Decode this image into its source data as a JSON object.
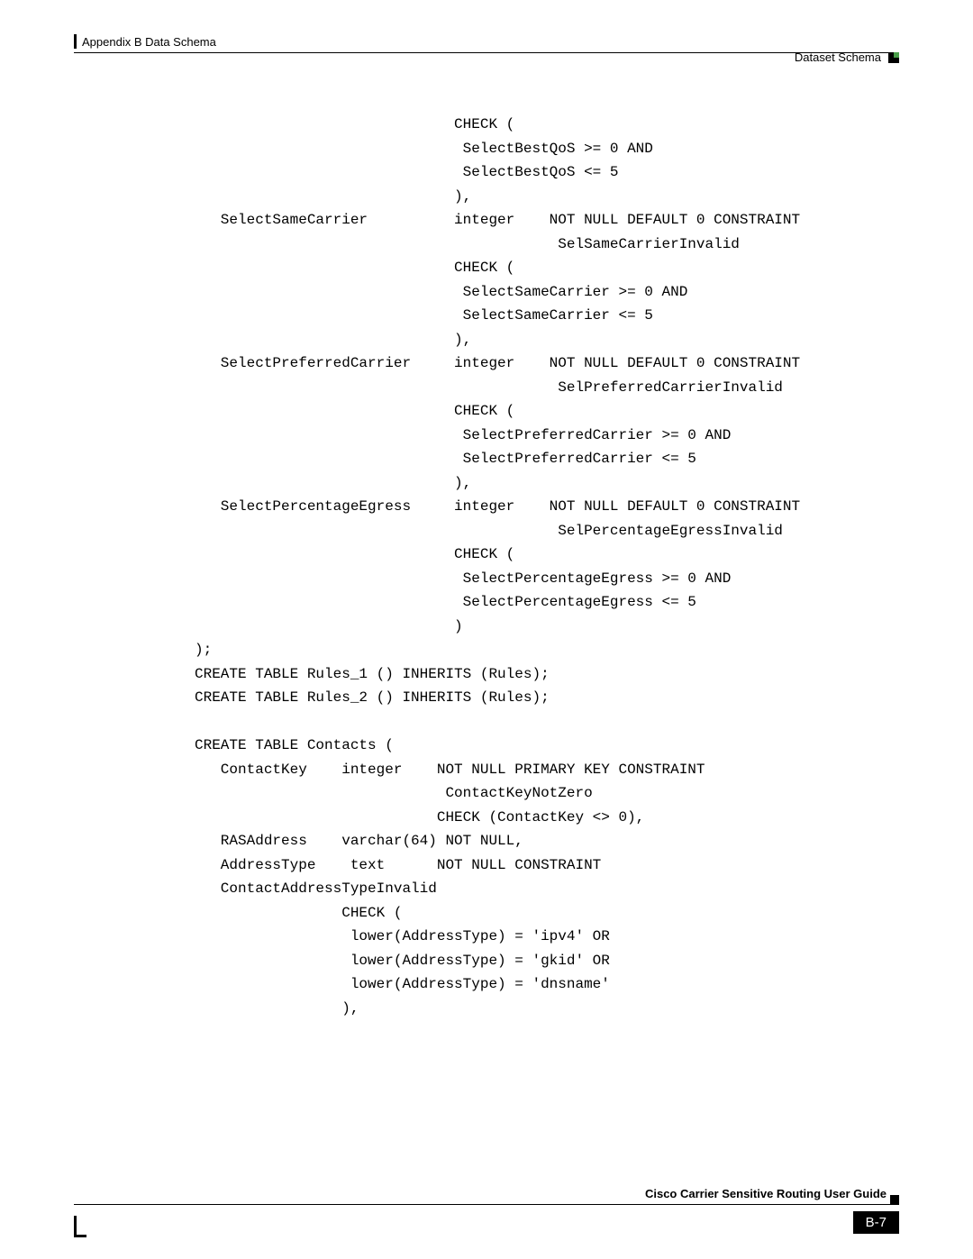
{
  "header": {
    "left": "Appendix B    Data Schema",
    "right": "Dataset Schema"
  },
  "code": "                              CHECK (\n                               SelectBestQoS >= 0 AND\n                               SelectBestQoS <= 5\n                              ),\n   SelectSameCarrier          integer    NOT NULL DEFAULT 0 CONSTRAINT\n                                          SelSameCarrierInvalid\n                              CHECK (\n                               SelectSameCarrier >= 0 AND\n                               SelectSameCarrier <= 5\n                              ),\n   SelectPreferredCarrier     integer    NOT NULL DEFAULT 0 CONSTRAINT\n                                          SelPreferredCarrierInvalid\n                              CHECK (\n                               SelectPreferredCarrier >= 0 AND\n                               SelectPreferredCarrier <= 5\n                              ),\n   SelectPercentageEgress     integer    NOT NULL DEFAULT 0 CONSTRAINT\n                                          SelPercentageEgressInvalid\n                              CHECK (\n                               SelectPercentageEgress >= 0 AND\n                               SelectPercentageEgress <= 5\n                              )\n);\nCREATE TABLE Rules_1 () INHERITS (Rules);\nCREATE TABLE Rules_2 () INHERITS (Rules);\n\nCREATE TABLE Contacts (\n   ContactKey    integer    NOT NULL PRIMARY KEY CONSTRAINT\n                             ContactKeyNotZero\n                            CHECK (ContactKey <> 0),\n   RASAddress    varchar(64) NOT NULL,\n   AddressType    text      NOT NULL CONSTRAINT\n   ContactAddressTypeInvalid\n                 CHECK (\n                  lower(AddressType) = 'ipv4' OR\n                  lower(AddressType) = 'gkid' OR\n                  lower(AddressType) = 'dnsname'\n                 ),",
  "footer": {
    "guide": "Cisco Carrier Sensitive Routing User Guide",
    "page": "B-7"
  }
}
